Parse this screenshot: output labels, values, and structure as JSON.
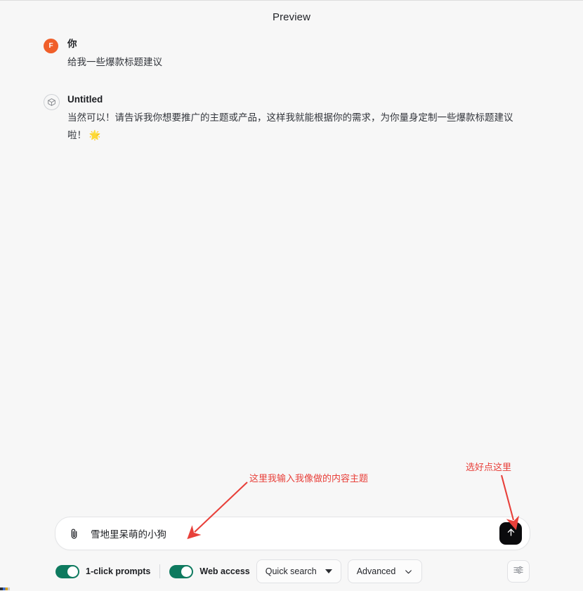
{
  "header": {
    "title": "Preview"
  },
  "conversation": {
    "messages": [
      {
        "avatar_letter": "F",
        "avatar_icon": "user-avatar-initial",
        "author": "你",
        "body": "给我一些爆款标题建议"
      },
      {
        "avatar_icon": "cube-icon",
        "author": "Untitled",
        "body": "当然可以！请告诉我你想要推广的主题或产品，这样我就能根据你的需求，为你量身定制一些爆款标题建议啦！ 🌟"
      }
    ]
  },
  "composer": {
    "attach_icon": "paperclip-icon",
    "value": "雪地里呆萌的小狗",
    "placeholder": "",
    "send_icon": "arrow-up-icon"
  },
  "toolbar": {
    "toggles": [
      {
        "label": "1-click prompts",
        "on": true
      },
      {
        "label": "Web access",
        "on": true
      }
    ],
    "dropdowns": [
      {
        "label": "Quick search",
        "caret": "triangle-down-icon"
      },
      {
        "label": "Advanced",
        "caret": "chevron-down-icon"
      }
    ],
    "settings_icon": "sliders-icon"
  },
  "annotations": [
    {
      "text": "这里我输入我像做的内容主题",
      "color": "#e8403a"
    },
    {
      "text": "选好点这里",
      "color": "#e8403a"
    }
  ],
  "colors": {
    "background": "#f7f7f7",
    "accent_toggle": "#0e7a5f",
    "avatar_user": "#f05f2a",
    "send_button": "#0b0b0d",
    "annotation": "#e8403a"
  }
}
